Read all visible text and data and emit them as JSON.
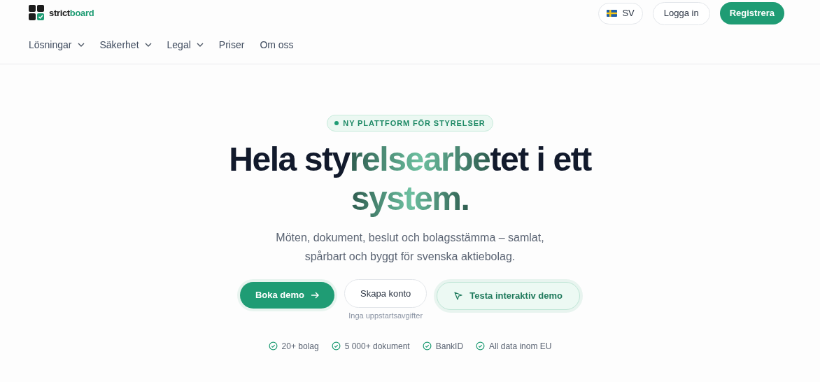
{
  "logo": {
    "text_main": "strict",
    "text_accent": "board"
  },
  "header": {
    "language": "SV",
    "login": "Logga in",
    "register": "Registrera"
  },
  "nav": [
    {
      "label": "Lösningar",
      "dropdown": true
    },
    {
      "label": "Säkerhet",
      "dropdown": true
    },
    {
      "label": "Legal",
      "dropdown": true
    },
    {
      "label": "Priser",
      "dropdown": false
    },
    {
      "label": "Om oss",
      "dropdown": false
    }
  ],
  "hero": {
    "badge": "NY PLATTFORM FÖR STYRELSER",
    "headline": [
      {
        "text": "Hela sty",
        "accent": false
      },
      {
        "text": "relsearbe",
        "accent": true
      },
      {
        "text": "tet i ett ",
        "accent": false
      },
      {
        "text": "system.",
        "accent": true
      }
    ],
    "subtitle": "Möten, dokument, beslut och bolagsstämma – samlat, spårbart och byggt för svenska aktiebolag.",
    "primary_button": "Boka demo",
    "secondary_button": "Skapa konto",
    "secondary_note": "Inga uppstartsavgifter",
    "demo_button": "Testa interaktiv demo",
    "facts": [
      "20+ bolag",
      "5 000+ dokument",
      "BankID",
      "All data inom EU"
    ]
  }
}
